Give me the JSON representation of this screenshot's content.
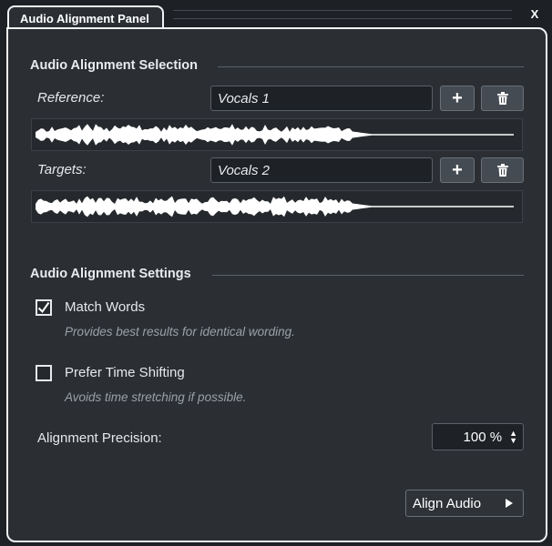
{
  "tab": {
    "title": "Audio Alignment Panel",
    "close": "X"
  },
  "selection": {
    "title": "Audio Alignment Selection",
    "reference": {
      "label": "Reference:",
      "value": "Vocals 1",
      "add": "+",
      "delete_icon": "trash-icon"
    },
    "targets": {
      "label": "Targets:",
      "value": "Vocals 2",
      "add": "+",
      "delete_icon": "trash-icon"
    }
  },
  "settings": {
    "title": "Audio Alignment Settings",
    "match_words": {
      "label": "Match Words",
      "checked": true,
      "hint": "Provides best results for identical wording."
    },
    "prefer_time_shifting": {
      "label": "Prefer Time Shifting",
      "checked": false,
      "hint": "Avoids time stretching if possible."
    },
    "precision": {
      "label": "Alignment Precision:",
      "value": "100 %"
    }
  },
  "align_button": {
    "label": "Align Audio",
    "icon": "play-triangle-icon"
  },
  "colors": {
    "background": "#2b2f34",
    "border": "#f1f2f3",
    "field": "#1e2125",
    "waveform": "#ffffff"
  }
}
